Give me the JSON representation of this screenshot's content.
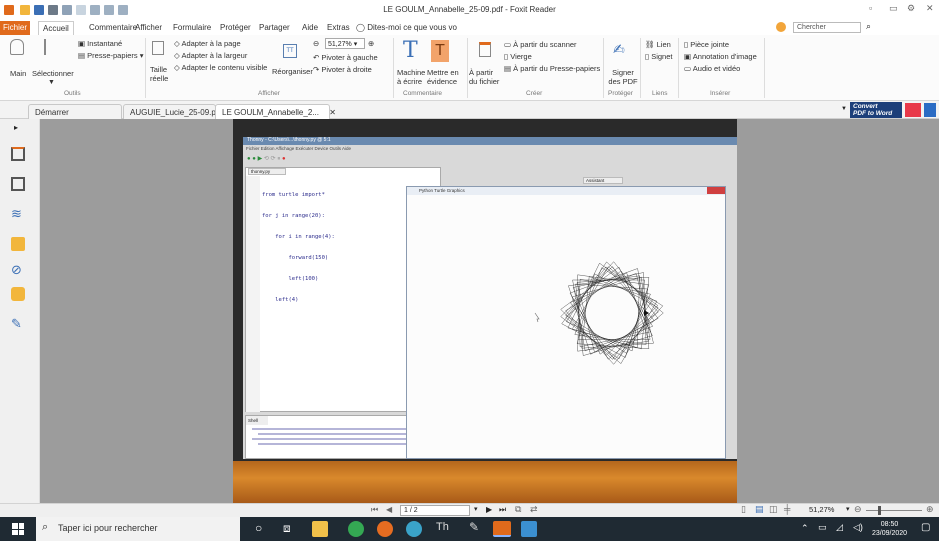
{
  "app": {
    "title": "LE GOULM_Annabelle_25-09.pdf - Foxit Reader",
    "search_placeholder": "Chercher",
    "accent": "#e06a1c"
  },
  "menu": {
    "items": [
      "Fichier",
      "Accueil",
      "Commentaire",
      "Afficher",
      "Formulaire",
      "Protéger",
      "Partager",
      "Aide",
      "Extras"
    ],
    "tell_me": "Dites-moi ce que vous vo"
  },
  "ribbon": {
    "main": "Main",
    "select": "Sélectionner",
    "snapshot": "Instantané",
    "clipboard": "Presse-papiers",
    "actual_size": "Taille réelle",
    "fit_page": "Adapter à la page",
    "fit_width": "Adapter à la largeur",
    "fit_visible": "Adapter le contenu visible",
    "zoom": "51,27%",
    "reorganize": "Réorganiser",
    "rotate_left": "Pivoter à gauche",
    "rotate_right": "Pivoter à droite",
    "typewriter": "Machine à écrire",
    "highlight": "Mettre en évidence",
    "from_file": "À partir du fichier",
    "from_scanner": "À partir du scanner",
    "blank": "Vierge",
    "from_clipboard": "À partir du Presse-papiers",
    "sign": "Signer des PDF",
    "link": "Lien",
    "bookmark": "Signet",
    "attachment": "Pièce jointe",
    "image_annotation": "Annotation d'image",
    "audio_video": "Audio et vidéo",
    "groups": [
      "Outils",
      "Afficher",
      "Commentaire",
      "Créer",
      "Protéger",
      "Liens",
      "Insérer"
    ]
  },
  "tabs": [
    "Démarrer",
    "AUGUIE_Lucie_25-09.pdf",
    "LE GOULM_Annabelle_2..."
  ],
  "convert": {
    "line1": "Convert",
    "line2": "PDF to Word"
  },
  "photo": {
    "window_title": "Thonny - C:\\Users\\...\\thonny.py @ 5:1",
    "menu": "Fichier  Edition  Affichage  Exécuter  Device  Outils  Aide",
    "file_tab": "thonny.py",
    "code": [
      "from turtle import*",
      "for j in range(20):",
      "    for i in range(4):",
      "        forward(150)",
      "        left(100)",
      "    left(4)"
    ],
    "turtle_title": "Python Turtle Graphics",
    "assistant": "Assistant",
    "shell": "Shell"
  },
  "status": {
    "page": "1 / 2",
    "zoom": "51,27%"
  },
  "taskbar": {
    "search": "Taper ici pour rechercher",
    "time": "08:50",
    "date": "23/09/2020"
  }
}
